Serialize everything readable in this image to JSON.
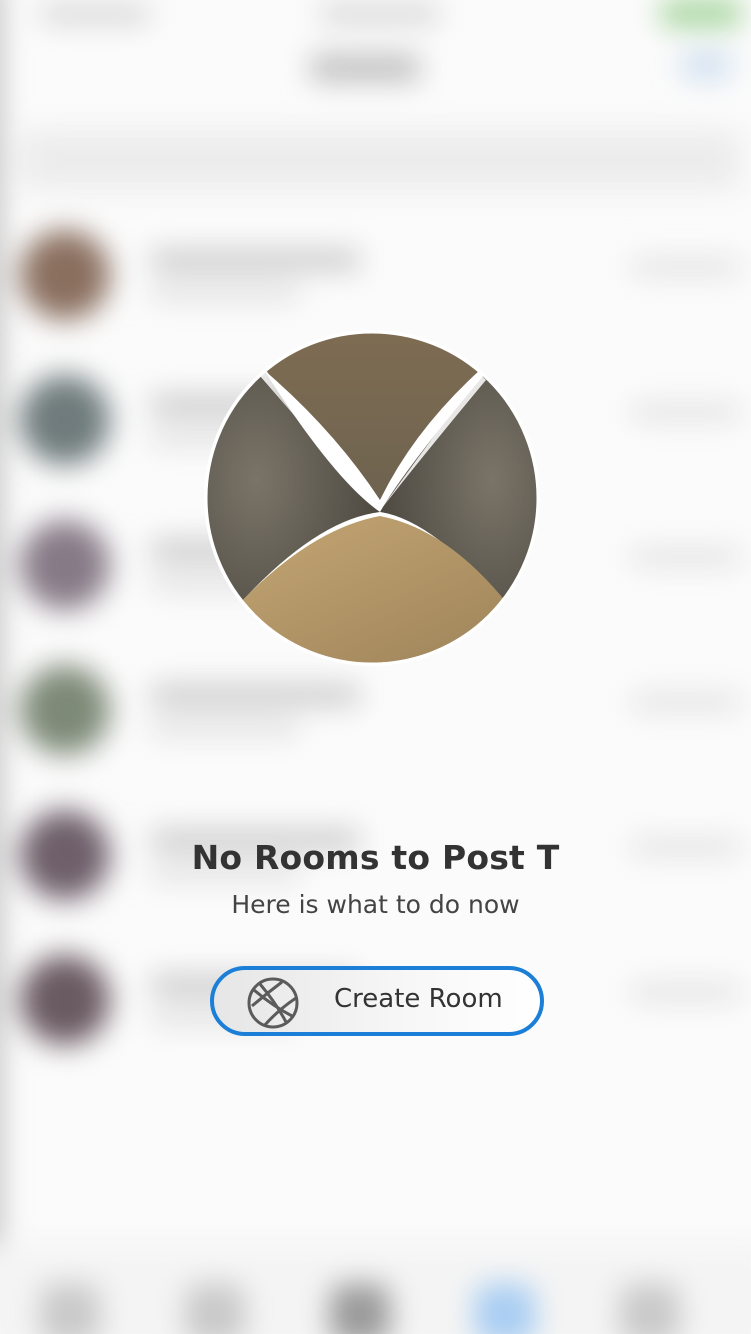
{
  "empty_state": {
    "title": "No Rooms to Post T",
    "subtitle": "Here is what to do now",
    "create_button_label": "Create Room",
    "create_button_icon": "globe-icon",
    "logo_icon": "app-logo-icon"
  },
  "colors": {
    "accent": "#1b7fd8",
    "title_text": "#333333",
    "logo_dark": "#5a5347",
    "logo_gold": "#b89a68",
    "logo_top": "#7a6a50"
  }
}
